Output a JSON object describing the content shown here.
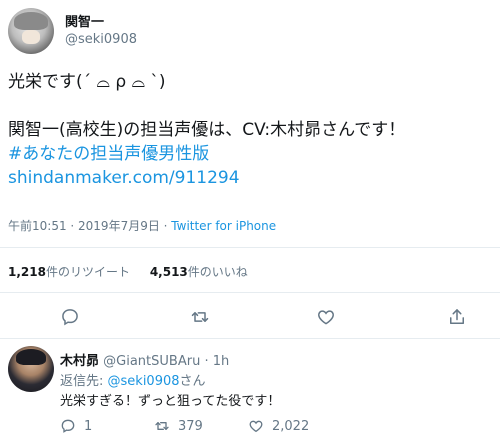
{
  "tweet": {
    "author": {
      "display_name": "関智一",
      "handle": "@seki0908"
    },
    "line1": "光栄です(´ ⌓ ρ ⌓ `)",
    "line2": "関智一(高校生)の担当声優は、CV:木村昴さんです！",
    "hashtag": "#あなたの担当声優男性版",
    "url": "shindanmaker.com/911294",
    "timestamp": "午前10:51 · 2019年7月9日 · ",
    "source": "Twitter for iPhone",
    "retweets": {
      "count": "1,218",
      "label": "件のリツイート"
    },
    "likes": {
      "count": "4,513",
      "label": "件のいいね"
    }
  },
  "actions": {
    "icons": [
      "reply-icon",
      "retweet-icon",
      "like-icon",
      "share-icon"
    ]
  },
  "reply": {
    "author": {
      "display_name": "木村昴",
      "handle": "@GiantSUBAru",
      "time": "· 1h"
    },
    "replying_to_prefix": "返信先: ",
    "replying_to_handle": "@seki0908",
    "replying_to_suffix": "さん",
    "text": "光栄すぎる！ずっと狙ってた役です！",
    "reply_count": "1",
    "retweet_count": "379",
    "like_count": "2,022"
  },
  "colors": {
    "link": "#1b95e0",
    "secondary": "#657786",
    "text": "#14171a",
    "divider": "#e6ecf0"
  }
}
